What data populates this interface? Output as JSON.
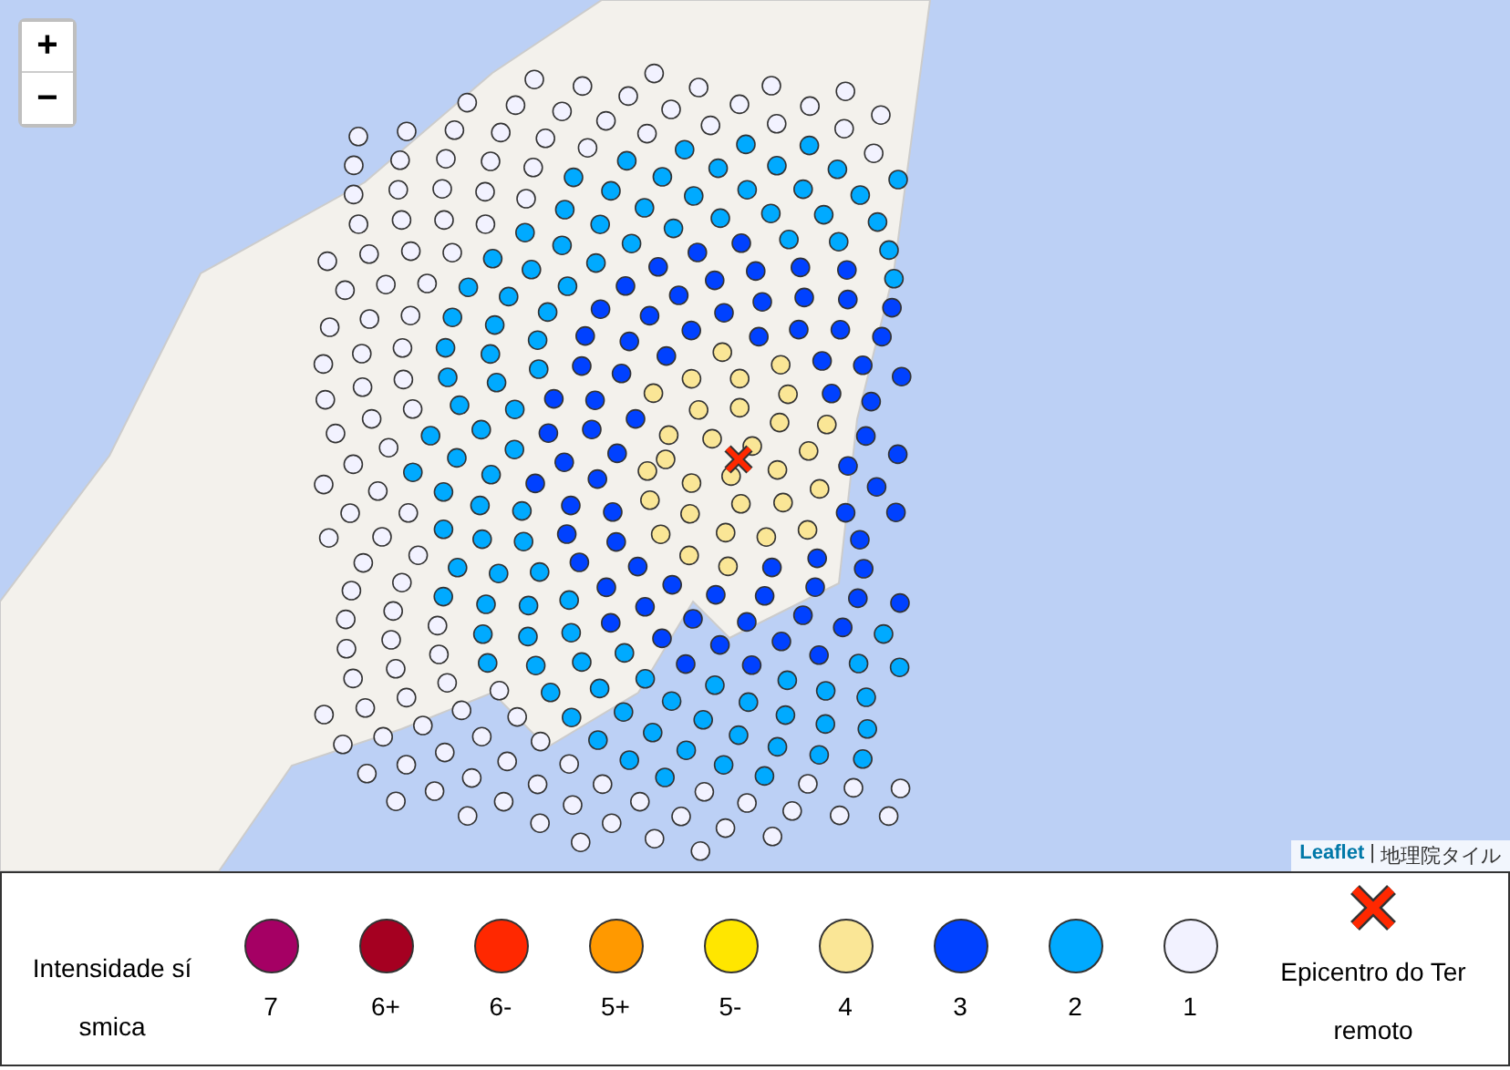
{
  "map": {
    "zoom_controls": [
      {
        "label": "+"
      },
      {
        "label": "−"
      }
    ],
    "attribution": {
      "link": "Leaflet",
      "separator": "|",
      "source": "地理院タイル"
    }
  },
  "legend": {
    "title": "Intensidade sísmica",
    "items": [
      {
        "label": "7",
        "color": "#a50064"
      },
      {
        "label": "6+",
        "color": "#a50021"
      },
      {
        "label": "6-",
        "color": "#ff2800"
      },
      {
        "label": "5+",
        "color": "#ff9900"
      },
      {
        "label": "5-",
        "color": "#ffe600"
      },
      {
        "label": "4",
        "color": "#fae696"
      },
      {
        "label": "3",
        "color": "#0041ff"
      },
      {
        "label": "2",
        "color": "#00aaff"
      },
      {
        "label": "1",
        "color": "#f2f2ff"
      }
    ],
    "epicenter_label": "Epicentro do Terremoto"
  }
}
